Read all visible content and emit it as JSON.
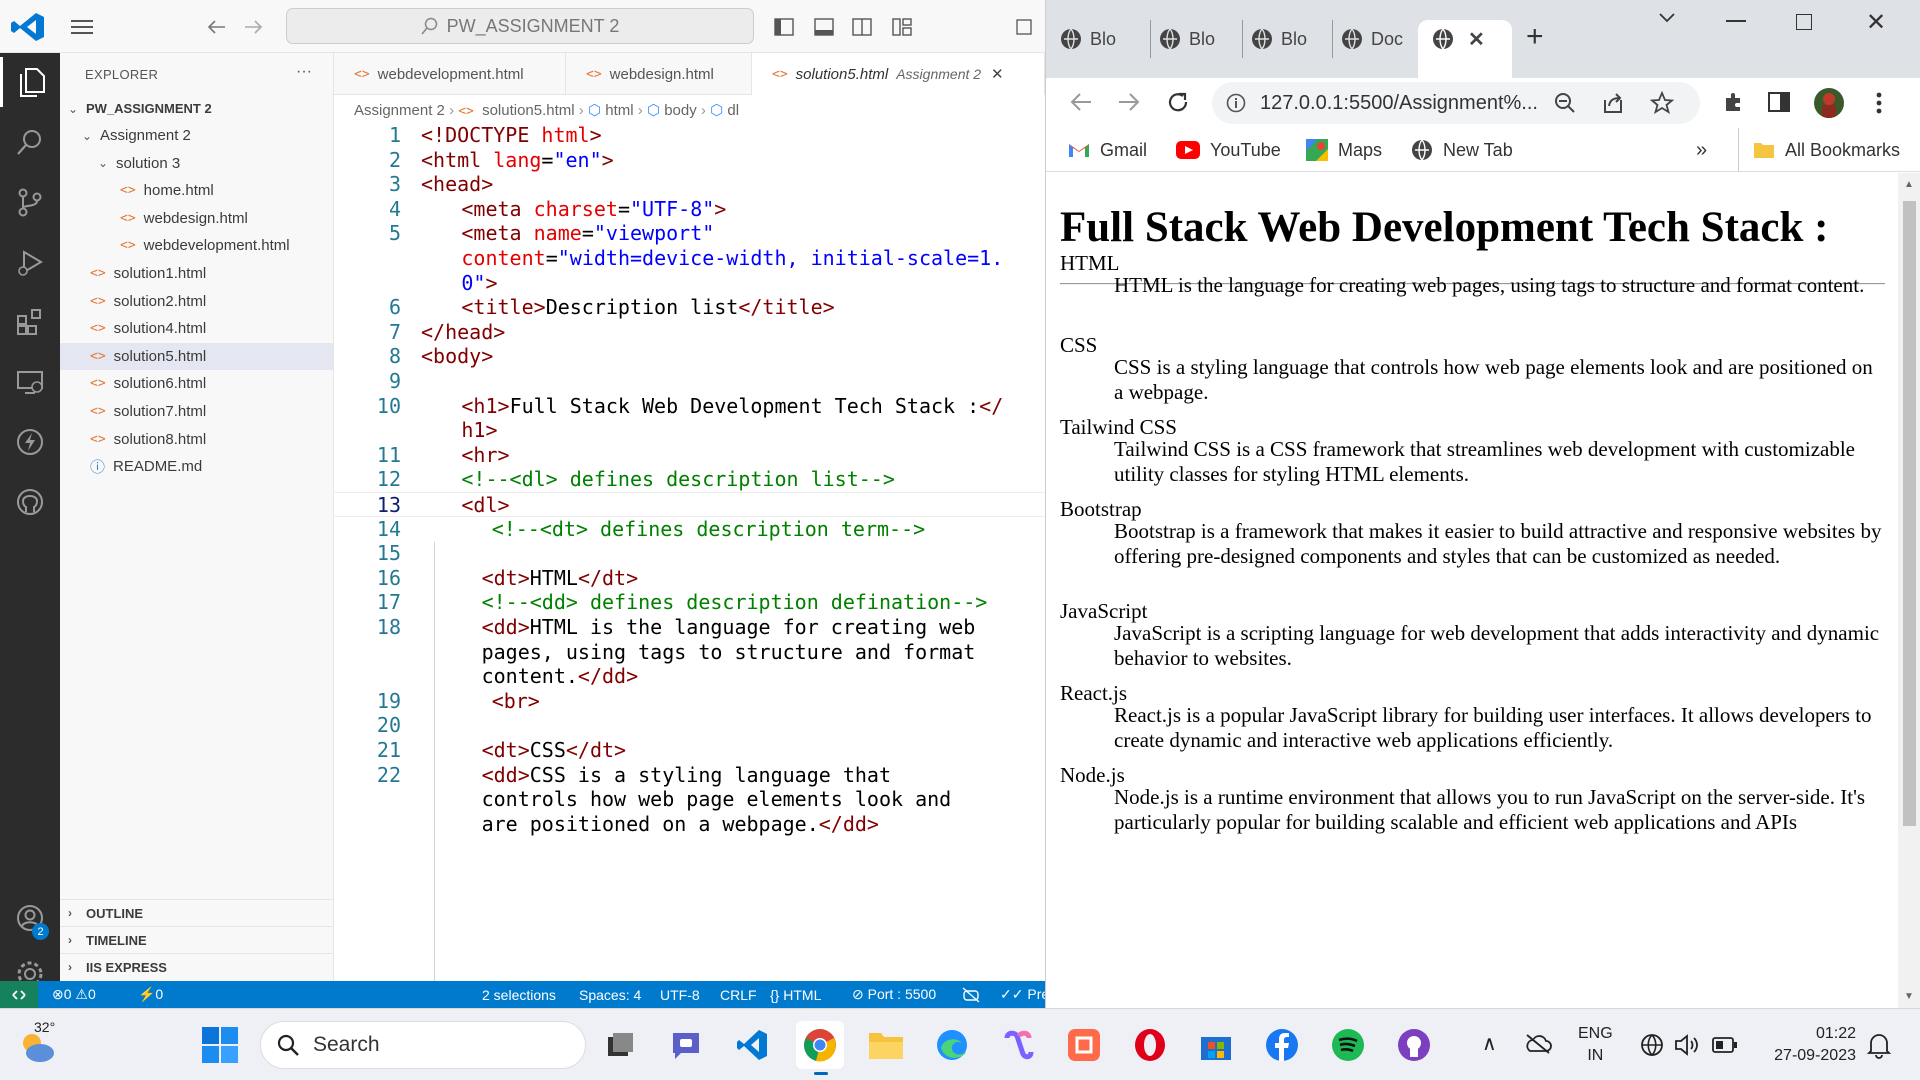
{
  "vscode": {
    "search_text": "PW_ASSIGNMENT 2",
    "explorer_title": "EXPLORER",
    "explorer_more": "···",
    "root_folder": "PW_ASSIGNMENT 2",
    "tree": [
      {
        "label": "Assignment 2",
        "type": "folder"
      },
      {
        "label": "solution 3",
        "type": "folder"
      },
      {
        "label": "home.html",
        "type": "html"
      },
      {
        "label": "webdesign.html",
        "type": "html"
      },
      {
        "label": "webdevelopment.html",
        "type": "html"
      },
      {
        "label": "solution1.html",
        "type": "html"
      },
      {
        "label": "solution2.html",
        "type": "html"
      },
      {
        "label": "solution4.html",
        "type": "html"
      },
      {
        "label": "solution5.html",
        "type": "html",
        "selected": true
      },
      {
        "label": "solution6.html",
        "type": "html"
      },
      {
        "label": "solution7.html",
        "type": "html"
      },
      {
        "label": "solution8.html",
        "type": "html"
      },
      {
        "label": "README.md",
        "type": "info"
      }
    ],
    "sections": [
      "OUTLINE",
      "TIMELINE",
      "IIS EXPRESS"
    ],
    "tabs": [
      {
        "label": "webdevelopment.html"
      },
      {
        "label": "webdesign.html"
      },
      {
        "label": "solution5.html",
        "sub": "Assignment 2",
        "active": true
      }
    ],
    "close_glyph": "✕",
    "breadcrumb": [
      "Assignment 2",
      "solution5.html",
      "html",
      "body",
      "dl"
    ],
    "current_line": "13",
    "code_lines": [
      {
        "n": "1",
        "indent": 0,
        "parts": [
          {
            "t": "<!DOCTYPE ",
            "c": "tg"
          },
          {
            "t": "html",
            "c": "at"
          },
          {
            "t": ">",
            "c": "tg"
          }
        ]
      },
      {
        "n": "2",
        "indent": 0,
        "parts": [
          {
            "t": "<html ",
            "c": "tg"
          },
          {
            "t": "lang",
            "c": "at"
          },
          {
            "t": "=",
            "c": "pl"
          },
          {
            "t": "\"en\"",
            "c": "st"
          },
          {
            "t": ">",
            "c": "tg"
          }
        ]
      },
      {
        "n": "3",
        "indent": 0,
        "parts": [
          {
            "t": "<head>",
            "c": "tg"
          }
        ]
      },
      {
        "n": "4",
        "indent": 4,
        "parts": [
          {
            "t": "<meta ",
            "c": "tg"
          },
          {
            "t": "charset",
            "c": "at"
          },
          {
            "t": "=",
            "c": "pl"
          },
          {
            "t": "\"UTF-8\"",
            "c": "st"
          },
          {
            "t": ">",
            "c": "tg"
          }
        ]
      },
      {
        "n": "5",
        "indent": 4,
        "parts": [
          {
            "t": "<meta ",
            "c": "tg"
          },
          {
            "t": "name",
            "c": "at"
          },
          {
            "t": "=",
            "c": "pl"
          },
          {
            "t": "\"viewport\"",
            "c": "st"
          }
        ]
      },
      {
        "n": "",
        "indent": 4,
        "parts": [
          {
            "t": "content",
            "c": "at"
          },
          {
            "t": "=",
            "c": "pl"
          },
          {
            "t": "\"width=device-width, initial-scale=1.",
            "c": "st"
          }
        ]
      },
      {
        "n": "",
        "indent": 4,
        "parts": [
          {
            "t": "0\"",
            "c": "st"
          },
          {
            "t": ">",
            "c": "tg"
          }
        ]
      },
      {
        "n": "6",
        "indent": 4,
        "parts": [
          {
            "t": "<title>",
            "c": "tg"
          },
          {
            "t": "Description list",
            "c": "pl"
          },
          {
            "t": "</title>",
            "c": "tg"
          }
        ]
      },
      {
        "n": "7",
        "indent": 0,
        "parts": [
          {
            "t": "</head>",
            "c": "tg"
          }
        ]
      },
      {
        "n": "8",
        "indent": 0,
        "parts": [
          {
            "t": "<body>",
            "c": "tg"
          }
        ]
      },
      {
        "n": "9",
        "indent": 0,
        "parts": []
      },
      {
        "n": "10",
        "indent": 4,
        "parts": [
          {
            "t": "<h1>",
            "c": "tg"
          },
          {
            "t": "Full Stack Web Development Tech Stack :",
            "c": "pl"
          },
          {
            "t": "</",
            "c": "tg"
          }
        ]
      },
      {
        "n": "",
        "indent": 4,
        "parts": [
          {
            "t": "h1>",
            "c": "tg"
          }
        ]
      },
      {
        "n": "11",
        "indent": 4,
        "parts": [
          {
            "t": "<hr>",
            "c": "tg"
          }
        ]
      },
      {
        "n": "12",
        "indent": 4,
        "parts": [
          {
            "t": "<!--<dl> defines description list-->",
            "c": "cm"
          }
        ]
      },
      {
        "n": "13",
        "indent": 4,
        "parts": [
          {
            "t": "<dl>",
            "c": "tg"
          }
        ]
      },
      {
        "n": "14",
        "indent": 7,
        "parts": [
          {
            "t": "<!--<dt> defines description term-->",
            "c": "cm"
          }
        ]
      },
      {
        "n": "15",
        "indent": 0,
        "parts": []
      },
      {
        "n": "16",
        "indent": 6,
        "parts": [
          {
            "t": "<dt>",
            "c": "tg"
          },
          {
            "t": "HTML",
            "c": "pl"
          },
          {
            "t": "</dt>",
            "c": "tg"
          }
        ]
      },
      {
        "n": "17",
        "indent": 6,
        "parts": [
          {
            "t": "<!--<dd> defines description defination-->",
            "c": "cm"
          }
        ]
      },
      {
        "n": "18",
        "indent": 6,
        "parts": [
          {
            "t": "<dd>",
            "c": "tg"
          },
          {
            "t": "HTML is the language for creating web",
            "c": "pl"
          }
        ]
      },
      {
        "n": "",
        "indent": 6,
        "parts": [
          {
            "t": "pages, using tags to structure and format",
            "c": "pl"
          }
        ]
      },
      {
        "n": "",
        "indent": 6,
        "parts": [
          {
            "t": "content.",
            "c": "pl"
          },
          {
            "t": "</dd>",
            "c": "tg"
          }
        ]
      },
      {
        "n": "19",
        "indent": 7,
        "parts": [
          {
            "t": "<br>",
            "c": "tg"
          }
        ]
      },
      {
        "n": "20",
        "indent": 0,
        "parts": []
      },
      {
        "n": "21",
        "indent": 6,
        "parts": [
          {
            "t": "<dt>",
            "c": "tg"
          },
          {
            "t": "CSS",
            "c": "pl"
          },
          {
            "t": "</dt>",
            "c": "tg"
          }
        ]
      },
      {
        "n": "22",
        "indent": 6,
        "parts": [
          {
            "t": "<dd>",
            "c": "tg"
          },
          {
            "t": "CSS is a styling language that",
            "c": "pl"
          }
        ]
      },
      {
        "n": "",
        "indent": 6,
        "parts": [
          {
            "t": "controls how web page elements look and",
            "c": "pl"
          }
        ]
      },
      {
        "n": "",
        "indent": 6,
        "parts": [
          {
            "t": "are positioned on a webpage.",
            "c": "pl"
          },
          {
            "t": "</dd>",
            "c": "tg"
          }
        ]
      }
    ],
    "status": {
      "problems": "⊗0 ⚠0",
      "ports": "⚡0",
      "selections": "2 selections",
      "spaces": "Spaces: 4",
      "encoding": "UTF-8",
      "eol": "CRLF",
      "language": "{} HTML",
      "port": "⊘ Port : 5500",
      "prettier": "✓✓ Pre"
    },
    "accounts_badge": "2"
  },
  "chrome": {
    "tabs": [
      {
        "label": "Blo"
      },
      {
        "label": "Blo"
      },
      {
        "label": "Blo"
      },
      {
        "label": "Doc"
      },
      {
        "label": "",
        "active": true
      }
    ],
    "new_tab": "+",
    "url": "127.0.0.1:5500/Assignment%...",
    "bookmarks": [
      {
        "label": "Gmail",
        "icon": "gmail-icon"
      },
      {
        "label": "YouTube",
        "icon": "youtube-icon"
      },
      {
        "label": "Maps",
        "icon": "maps-icon"
      },
      {
        "label": "New Tab",
        "icon": "globe-icon"
      }
    ],
    "more_bookmarks": "»",
    "all_bookmarks": "All Bookmarks",
    "page": {
      "heading": "Full Stack Web Development Tech Stack :",
      "items": [
        {
          "term": "HTML",
          "desc": "HTML is the language for creating web pages, using tags to structure and format content."
        },
        {
          "term": "CSS",
          "desc": "CSS is a styling language that controls how web page elements look and are positioned on a webpage."
        },
        {
          "term": "Tailwind CSS",
          "desc": "Tailwind CSS is a CSS framework that streamlines web development with customizable utility classes for styling HTML elements."
        },
        {
          "term": "Bootstrap",
          "desc": "Bootstrap is a framework that makes it easier to build attractive and responsive websites by offering pre-designed components and styles that can be customized as needed."
        },
        {
          "term": "JavaScript",
          "desc": "JavaScript is a scripting language for web development that adds interactivity and dynamic behavior to websites."
        },
        {
          "term": "React.js",
          "desc": "React.js is a popular JavaScript library for building user interfaces. It allows developers to create dynamic and interactive web applications efficiently."
        },
        {
          "term": "Node.js",
          "desc": "Node.js is a runtime environment that allows you to run JavaScript on the server-side. It's particularly popular for building scalable and efficient web applications and APIs"
        }
      ]
    }
  },
  "taskbar": {
    "weather_temp": "32°",
    "search_placeholder": "Search",
    "lang_line1": "ENG",
    "lang_line2": "IN",
    "time": "01:22",
    "date": "27-09-2023",
    "tray_up": "∧"
  },
  "colors": {
    "vscode_blue": "#007acc",
    "activity_bar": "#2c2c2c",
    "chrome_tabstrip": "#dee1e6"
  }
}
